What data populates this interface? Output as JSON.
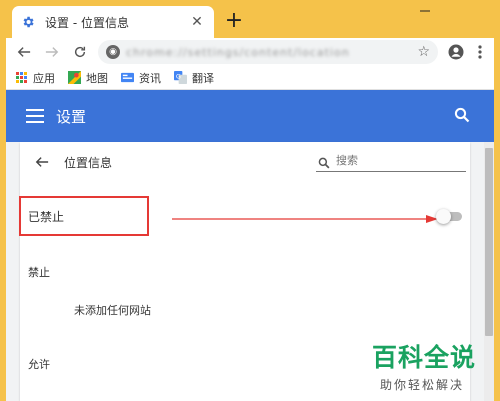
{
  "browser": {
    "tab_title": "设置 - 位置信息",
    "address_blurred": "chrome://settings/content/location",
    "bookmarks": [
      {
        "label": "应用",
        "icon": "apps-grid-icon"
      },
      {
        "label": "地图",
        "icon": "maps-icon"
      },
      {
        "label": "资讯",
        "icon": "news-icon"
      },
      {
        "label": "翻译",
        "icon": "translate-icon"
      }
    ]
  },
  "header": {
    "title": "设置",
    "accent": "#3b73d8"
  },
  "page": {
    "title": "位置信息",
    "search_placeholder": "搜索",
    "blocked_label": "已禁止",
    "blocked_toggle_on": false,
    "forbid_section": "禁止",
    "forbid_empty": "未添加任何网站",
    "allow_section": "允许"
  },
  "watermark": {
    "main": "百科全说",
    "sub": "助你轻松解决"
  }
}
